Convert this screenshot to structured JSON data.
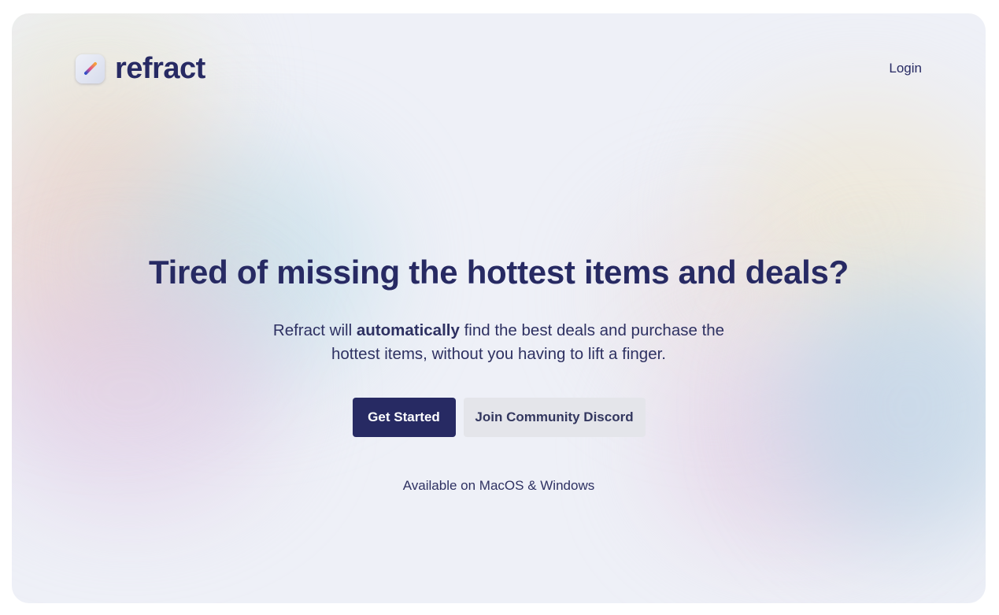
{
  "brand": {
    "name": "refract",
    "icon": "pen-stroke-icon"
  },
  "nav": {
    "login_label": "Login"
  },
  "hero": {
    "headline": "Tired of missing the hottest items and deals?",
    "sub_before": "Refract will ",
    "sub_bold": "automatically",
    "sub_after": " find the best deals and purchase the hottest items, without you having to lift a finger."
  },
  "actions": {
    "primary_label": "Get Started",
    "secondary_label": "Join Community Discord"
  },
  "availability": "Available on MacOS & Windows",
  "colors": {
    "brand_navy": "#272a63",
    "secondary_button": "#e4e5ea",
    "card_background": "#eef0f7"
  }
}
